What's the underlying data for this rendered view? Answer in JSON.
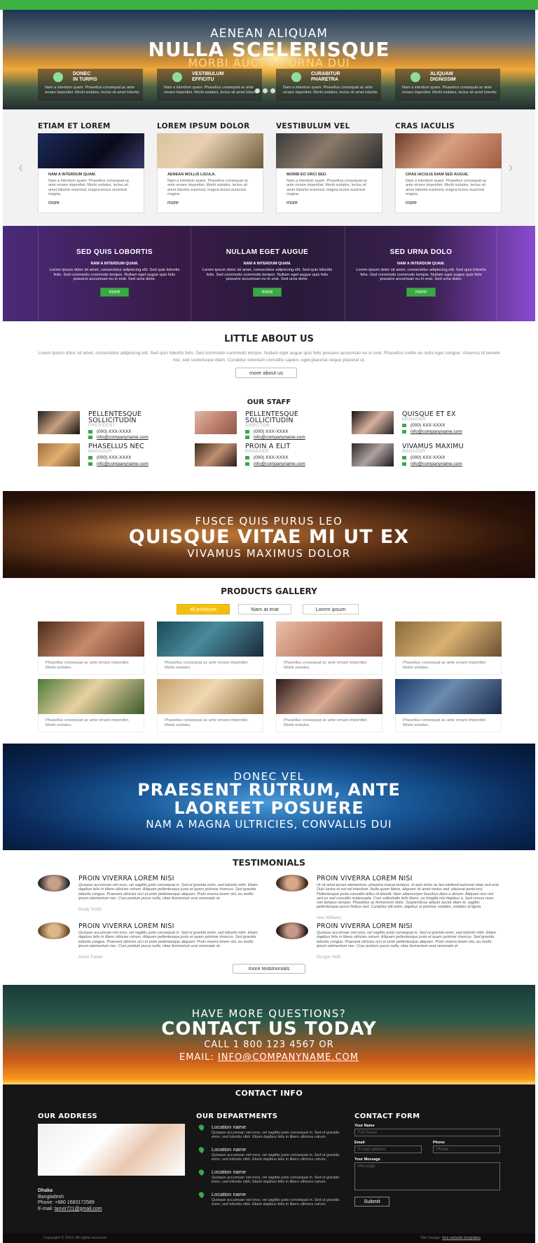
{
  "hero": {
    "line1": "AENEAN ALIQUAM",
    "line2": "NULLA SCELERISQUE",
    "line3": "MORBI AUCTOR URNA DUI",
    "features": [
      {
        "title1": "DONEC",
        "title2": "IN TURPIS",
        "text": "Nam a interdum quam. Phasellus consequat ac ante ornare imperdiet. Morbi sodales, lectus sit amet lobortis"
      },
      {
        "title1": "VESTIBULUM",
        "title2": "EFFICITU",
        "text": "Nam a interdum quam. Phasellus consequat ac ante ornare imperdiet. Morbi sodales, lectus sit amet lobortis"
      },
      {
        "title1": "CURABITUR",
        "title2": "PHARETRA",
        "text": "Nam a interdum quam. Phasellus consequat ac ante ornare imperdiet. Morbi sodales, lectus sit amet lobortis"
      },
      {
        "title1": "ALIQUAM",
        "title2": "DIGNISSIM",
        "text": "Nam a interdum quam. Phasellus consequat ac ante ornare imperdiet. Morbi sodales, lectus sit amet lobortis"
      }
    ]
  },
  "columns": [
    {
      "title": "ETIAM ET LOREM",
      "sub": "NAM A INTERDUM QUAM.",
      "text": "Nam a interdum quam. Phasellus consequat ac ante ornare imperdiet. Morbi sodales, lectus sit amet lobortis euismod, magna lectus euismod magna.",
      "more": "more"
    },
    {
      "title": "LOREM IPSUM DOLOR",
      "sub": "AENEAN MOLLIS LIGULA.",
      "text": "Nam a interdum quam. Phasellus consequat ac ante ornare imperdiet. Morbi sodales, lectus sit amet lobortis euismod, magna lectus euismod magna.",
      "more": "more"
    },
    {
      "title": "VESTIBULUM VEL",
      "sub": "MORBI EO ORCI SED.",
      "text": "Nam a interdum quam. Phasellus consequat ac ante ornare imperdiet. Morbi sodales, lectus sit amet lobortis euismod, magna lectus euismod magna.",
      "more": "more"
    },
    {
      "title": "CRAS IACULIS",
      "sub": "CRAS IACULIS DIAM SED AUGUE.",
      "text": "Nam a interdum quam. Phasellus consequat ac ante ornare imperdiet. Morbi sodales, lectus sit amet lobortis euismod, magna lectus euismod magna.",
      "more": "more"
    }
  ],
  "purple": [
    {
      "title": "SED QUIS LOBORTIS",
      "sub": "NAM A INTERDUM QUAM.",
      "text": "Lorem ipsum dolor sit amet, consectetur adipiscing elit. Sed quis lobortis felis. Sed commodo commodo tempor. Nullam eget augue quis felis posuere accumsan eu in erat. Sed urna dolor.",
      "btn": "more"
    },
    {
      "title": "NULLAM EGET AUGUE",
      "sub": "NAM A INTERDUM QUAM.",
      "text": "Lorem ipsum dolor sit amet, consectetur adipiscing elit. Sed quis lobortis felis. Sed commodo commodo tempor. Nullam eget augue quis felis posuere accumsan eu in erat. Sed urna dolor.",
      "btn": "more"
    },
    {
      "title": "SED URNA DOLO",
      "sub": "NAM A INTERDUM QUAM.",
      "text": "Lorem ipsum dolor sit amet, consectetur adipiscing elit. Sed quis lobortis felis. Sed commodo commodo tempor. Nullam eget augue quis felis posuere accumsan eu in erat. Sed urna dolor.",
      "btn": "more"
    }
  ],
  "about": {
    "title": "LITTLE ABOUT US",
    "text": "Lorem ipsum dolor sit amet, consectetur adipiscing elit. Sed quis lobortis felis. Sed commodo commodo tempor. Nullam eget augue quis felis posuere accumsan eu in erat. Phasellus mollis eu nulla eget congue. Vivamus id laoreet nisi, sed scelerisque diam. Curabitur interdum convallis sapien, eget placerat neque placerat ut.",
    "btn": "more about us"
  },
  "staff": {
    "title": "OUR STAFF",
    "members": [
      {
        "name1": "PELLENTESQUE",
        "name2": "SOLLICITUDIN",
        "role": "PRESIDENT",
        "phone": "(000) XXX-XXXX",
        "email": "info@companyname.com"
      },
      {
        "name1": "PELLENTESQUE",
        "name2": "SOLLICITUDIN",
        "role": "DIRECTOR",
        "phone": "(000) XXX-XXXX",
        "email": "info@companyname.com"
      },
      {
        "name1": "QUISQUE ET EX",
        "name2": "",
        "role": "MANAGER",
        "phone": "(000) XXX-XXXX",
        "email": "info@companyname.com"
      },
      {
        "name1": "PHASELLUS NEC",
        "name2": "",
        "role": "MANAGER",
        "phone": "(000) XXX-XXXX",
        "email": "info@companyname.com"
      },
      {
        "name1": "PROIN A ELIT",
        "name2": "",
        "role": "MANAGER",
        "phone": "(000) XXX-XXXX",
        "email": "info@companyname.com"
      },
      {
        "name1": "VIVAMUS MAXIMU",
        "name2": "",
        "role": "MANAGER",
        "phone": "(000) XXX-XXXX",
        "email": "info@companyname.com"
      }
    ]
  },
  "banner2": {
    "line1": "FUSCE QUIS PURUS LEO",
    "line2": "QUISQUE VITAE MI UT EX",
    "line3": "VIVAMUS MAXIMUS DOLOR"
  },
  "gallery": {
    "title": "PRODUCTS GALLERY",
    "tabs": [
      "all products",
      "Nam at erat",
      "Lorem ipsum"
    ],
    "caption": "Phasellus consequat ac ante ornare imperdiet. Morbi sodales."
  },
  "banner3": {
    "line1": "DONEC VEL",
    "line2": "PRAESENT RUTRUM, ANTE",
    "line3": "LAOREET POSUERE",
    "line4": "NAM A MAGNA ULTRICIES, CONVALLIS DUI"
  },
  "testimonials": {
    "title": "TESTIMONIALS",
    "btn": "more testimonials",
    "items": [
      {
        "title": "PROIN VIVERRA LOREM NISI",
        "text": "Quisque accumsan nisl eros, vel sagittis justo consequat in. Sed ut gravida enim, sed lobortis nibh. Etiam dapibus felis in libero ultricies rutrum. Aliquam pellentesque justo et quam pulvinar rhoncus. Sed gravida lobortis congue. Praesent ultricies orci et enim pellentesque aliquam. Proin viverra lorem nisi, eu mollis ipsum elementum nec. Cras pretium purus nulla, vitae fermentum erat venenatis et.",
        "author": "Brady Smith"
      },
      {
        "title": "PROIN VIVERRA LOREM NISI",
        "text": "Ut sit amet ipsum elementum, pharetra massa tempus. In quis tortor ac leo eleifend euismod vitae sed erat. Duis luctus et est vel interdum. Nulla quam libero, aliquam sit amet metus sed, placerat porta orci. Pellentesque porta convallis tellus id blandit. Nam ullamcorper faucibus diam a dictum. Aliquam non nisl sed ex sed convallis malesuada. Cras sollicitudin felis libero, eu fringilla nisl dapibus a. Sed cursus nunc non tempus semper. Phasellus ac fermentum dolor. Suspendisse aliquet auctor diam id, sagittis pellentesque purus finibus sed. Curabitur elit enim, dapibus ut pulvinar sodales, sodales id ligula.",
        "author": "Alex Williams"
      },
      {
        "title": "PROIN VIVERRA LOREM NISI",
        "text": "Quisque accumsan nisl eros, vel sagittis justo consequat in. Sed ut gravida enim, sed lobortis nibh. Etiam dapibus felis in libero ultricies rutrum. Aliquam pellentesque justo et quam pulvinar rhoncus. Sed gravida lobortis congue. Praesent ultricies orci et enim pellentesque aliquam. Proin viverra lorem nisi, eu mollis ipsum elementum nec. Cras pretium purus nulla, vitae fermentum erat venenatis et.",
        "author": "Adam Parker"
      },
      {
        "title": "PROIN VIVERRA LOREM NISI",
        "text": "Quisque accumsan nisl eros, vel sagittis justo consequat in. Sed ut gravida enim, sed lobortis nibh. Etiam dapibus felis in libero ultricies rutrum. Aliquam pellentesque justo et quam pulvinar rhoncus. Sed gravida lobortis congue. Praesent ultricies orci et enim pellentesque aliquam. Proin viverra lorem nisi, eu mollis ipsum elementum nec. Cras pretium purus nulla, vitae fermentum erat venenatis et.",
        "author": "Morgan Wolf"
      }
    ]
  },
  "contact_banner": {
    "line1": "HAVE MORE QUESTIONS?",
    "line2": "CONTACT US TODAY",
    "line3": "CALL 1 800 123 4567 OR",
    "line4a": "EMAIL: ",
    "line4b": "INFO@COMPANYNAME.COM"
  },
  "footer": {
    "title": "CONTACT INFO",
    "address": {
      "title": "OUR ADDRESS",
      "city": "Dhaka",
      "country": "Bangladesh",
      "phone": "Phone: +880 1683172589",
      "email_label": "E-mail: ",
      "email": "tanvir721@gmail.com"
    },
    "departments": {
      "title": "OUR DEPARTMENTS",
      "items": [
        {
          "title": "Location name",
          "text": "Quisque accumsan nisl eros, vel sagittis justo consequat in. Sed ut gravida enim, sed lobortis nibh. Etiam dapibus felis in libero ultricies rutrum."
        },
        {
          "title": "Location name",
          "text": "Quisque accumsan nisl eros, vel sagittis justo consequat in. Sed ut gravida enim, sed lobortis nibh. Etiam dapibus felis in libero ultricies rutrum."
        },
        {
          "title": "Location name",
          "text": "Quisque accumsan nisl eros, vel sagittis justo consequat in. Sed ut gravida enim, sed lobortis nibh. Etiam dapibus felis in libero ultricies rutrum."
        },
        {
          "title": "Location name",
          "text": "Quisque accumsan nisl eros, vel sagittis justo consequat in. Sed ut gravida enim, sed lobortis nibh. Etiam dapibus felis in libero ultricies rutrum."
        }
      ]
    },
    "form": {
      "title": "CONTACT FORM",
      "name_label": "Your Name",
      "name_ph": "Full Name",
      "email_label": "Email",
      "email_ph": "E-mail address",
      "phone_label": "Phone",
      "phone_ph": "Phone",
      "msg_label": "Your Message",
      "msg_ph": "Message",
      "submit": "Submit"
    },
    "copyright": "Copyright © 2015. All rights reserved.",
    "design_label": "Site Design: ",
    "design_link": "free website templates"
  },
  "colors": {
    "green": "#3db043",
    "yellow": "#f2c10f",
    "dark": "#161616"
  }
}
